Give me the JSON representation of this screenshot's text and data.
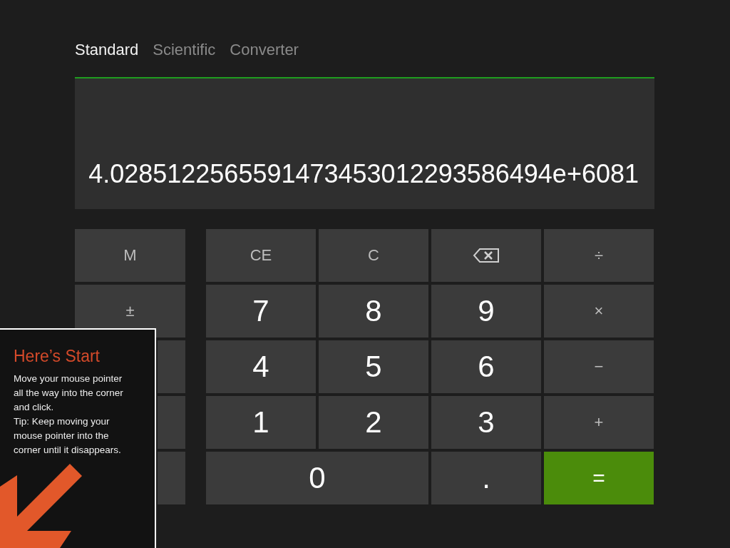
{
  "tabs": [
    {
      "label": "Standard",
      "selected": true
    },
    {
      "label": "Scientific",
      "selected": false
    },
    {
      "label": "Converter",
      "selected": false
    }
  ],
  "display": {
    "value": "4.0285122565591473453012293586494e+6081"
  },
  "memory_keys": [
    {
      "kind": "label",
      "label": "M"
    },
    {
      "kind": "label",
      "label": "±"
    },
    {
      "kind": "covered"
    },
    {
      "kind": "covered"
    },
    {
      "kind": "covered"
    }
  ],
  "keys": [
    {
      "kind": "op",
      "label": "CE"
    },
    {
      "kind": "op",
      "label": "C"
    },
    {
      "kind": "backspace"
    },
    {
      "kind": "op",
      "label": "÷"
    },
    {
      "kind": "digit",
      "label": "7"
    },
    {
      "kind": "digit",
      "label": "8"
    },
    {
      "kind": "digit",
      "label": "9"
    },
    {
      "kind": "op",
      "label": "×"
    },
    {
      "kind": "digit",
      "label": "4"
    },
    {
      "kind": "digit",
      "label": "5"
    },
    {
      "kind": "digit",
      "label": "6"
    },
    {
      "kind": "op",
      "label": "−"
    },
    {
      "kind": "digit",
      "label": "1"
    },
    {
      "kind": "digit",
      "label": "2"
    },
    {
      "kind": "digit",
      "label": "3"
    },
    {
      "kind": "op",
      "label": "+"
    },
    {
      "kind": "wide",
      "label": "0"
    },
    {
      "kind": "digit",
      "label": "."
    },
    {
      "kind": "equals",
      "label": "="
    }
  ],
  "tip": {
    "title": "Here’s Start",
    "body": "Move your mouse pointer all the way into the corner and click.\nTip: Keep moving your mouse pointer into the corner until it disappears."
  }
}
